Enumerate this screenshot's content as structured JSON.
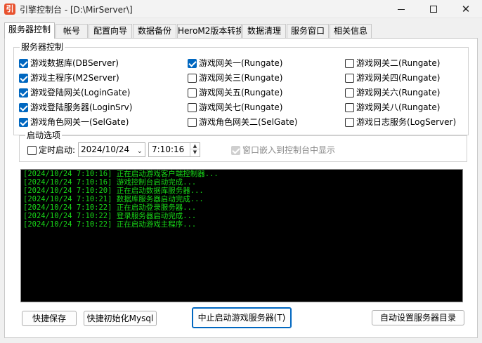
{
  "window": {
    "icon_glyph": "引",
    "title": "引擎控制台 - [D:\\MirServer\\]"
  },
  "tabs": [
    {
      "label": "服务器控制",
      "active": true
    },
    {
      "label": "帐号"
    },
    {
      "label": "配置向导"
    },
    {
      "label": "数据备份"
    },
    {
      "label": "HeroM2版本转换"
    },
    {
      "label": "数据清理"
    },
    {
      "label": "服务窗口"
    },
    {
      "label": "相关信息"
    }
  ],
  "services": {
    "legend": "服务器控制",
    "items": [
      {
        "label": "游戏数据库(DBServer)",
        "checked": true
      },
      {
        "label": "游戏主程序(M2Server)",
        "checked": true
      },
      {
        "label": "游戏登陆网关(LoginGate)",
        "checked": true
      },
      {
        "label": "游戏登陆服务器(LoginSrv)",
        "checked": true
      },
      {
        "label": "游戏角色网关一(SelGate)",
        "checked": true
      },
      {
        "label": "游戏网关一(Rungate)",
        "checked": true
      },
      {
        "label": "游戏网关三(Rungate)",
        "checked": false
      },
      {
        "label": "游戏网关五(Rungate)",
        "checked": false
      },
      {
        "label": "游戏网关七(Rungate)",
        "checked": false
      },
      {
        "label": "游戏角色网关二(SelGate)",
        "checked": false
      },
      {
        "label": "游戏网关二(Rungate)",
        "checked": false
      },
      {
        "label": "游戏网关四(Rungate)",
        "checked": false
      },
      {
        "label": "游戏网关六(Rungate)",
        "checked": false
      },
      {
        "label": "游戏网关八(Rungate)",
        "checked": false
      },
      {
        "label": "游戏日志服务(LogServer)",
        "checked": false
      }
    ]
  },
  "startup": {
    "legend": "启动选项",
    "timed_label": "定时启动:",
    "timed_checked": false,
    "date": "2024/10/24",
    "time": "7:10:16",
    "embed_label": "窗口嵌入到控制台中显示",
    "embed_checked": true
  },
  "log": [
    "[2024/10/24 7:10:16] 正在启动游戏客户端控制器...",
    "[2024/10/24 7:10:16] 游戏控制台启动完成...",
    "[2024/10/24 7:10:20] 正在启动数据库服务器...",
    "[2024/10/24 7:10:21] 数据库服务器启动完成...",
    "[2024/10/24 7:10:22] 正在启动登录服务器...",
    "[2024/10/24 7:10:22] 登录服务器启动完成...",
    "[2024/10/24 7:10:22] 正在启动游戏主程序..."
  ],
  "buttons": {
    "quick_save": "快捷保存",
    "quick_init_mysql": "快捷初始化Mysql",
    "stop_start": "中止启动游戏服务器(T)",
    "auto_dir": "自动设置服务器目录"
  },
  "colors": {
    "check_accent": "#0067c0",
    "log_text": "#18d818",
    "log_bg": "#000000"
  }
}
